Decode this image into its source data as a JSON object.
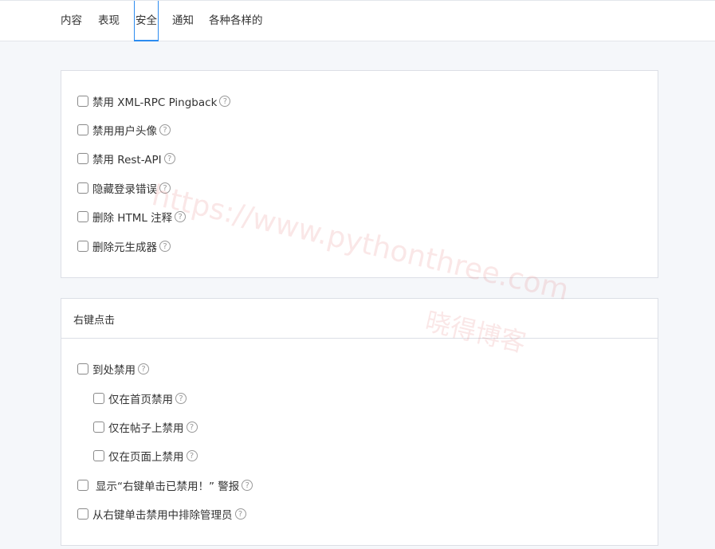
{
  "tabs": [
    {
      "label": "内容"
    },
    {
      "label": "表现"
    },
    {
      "label": "安全"
    },
    {
      "label": "通知"
    },
    {
      "label": "各种各样的"
    }
  ],
  "active_tab": "安全",
  "panel1": {
    "options": [
      {
        "label": "禁用 XML-RPC Pingback",
        "checked": false
      },
      {
        "label": "禁用用户头像",
        "checked": false
      },
      {
        "label": "禁用 Rest-API",
        "checked": false
      },
      {
        "label": "隐藏登录错误",
        "checked": false
      },
      {
        "label": "删除 HTML 注释",
        "checked": false
      },
      {
        "label": "删除元生成器",
        "checked": false
      }
    ]
  },
  "panel2": {
    "title": "右键点击",
    "options": [
      {
        "label": "到处禁用",
        "checked": false
      },
      {
        "label": "仅在首页禁用",
        "checked": false
      },
      {
        "label": "仅在帖子上禁用",
        "checked": false
      },
      {
        "label": "仅在页面上禁用",
        "checked": false
      },
      {
        "label": "显示“右键单击已禁用！” 警报",
        "checked": false
      },
      {
        "label": "从右键单击禁用中排除管理员",
        "checked": false
      }
    ]
  },
  "help_glyph": "?",
  "watermark": {
    "url": "https://www.pythonthree.com",
    "name": "晓得博客"
  }
}
